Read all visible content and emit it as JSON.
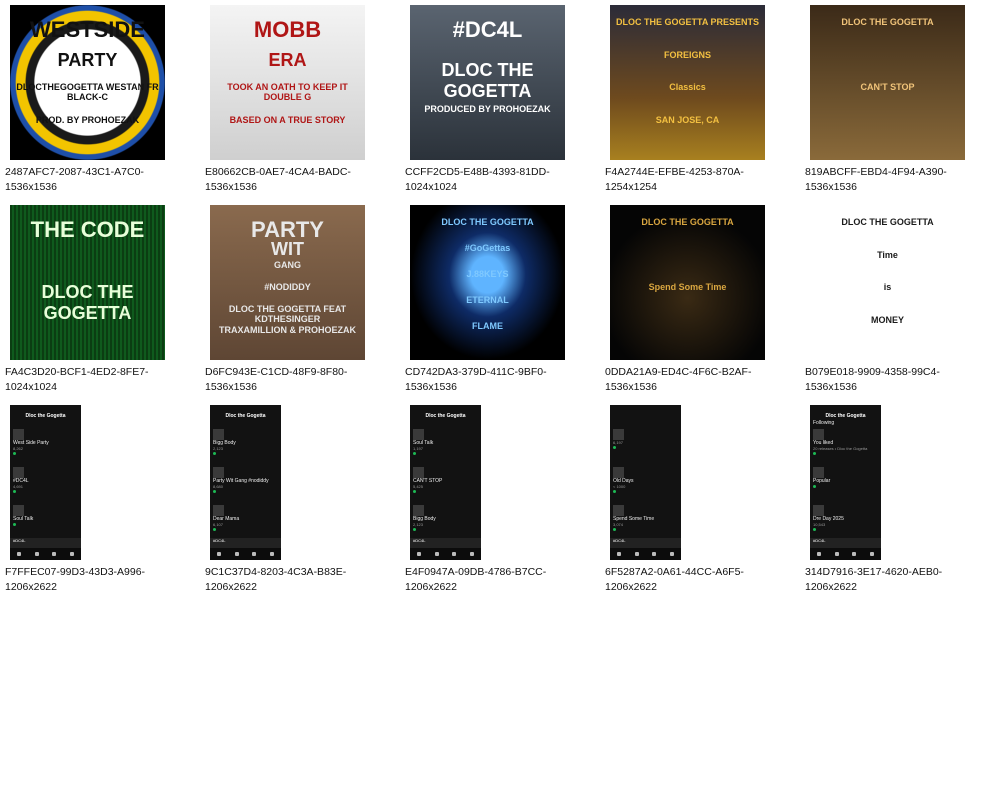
{
  "files": [
    {
      "line1": "2487AFC7-2087-43C1-A7C0-",
      "line2": "1536x1536",
      "kind": "album",
      "art": "westside",
      "texts": [
        "WESTSIDE",
        "PARTY",
        "DLOCTHEGOGETTA WESTAN FR BLACK-C",
        "PROD. BY PROHOEZAK"
      ]
    },
    {
      "line1": "E80662CB-0AE7-4CA4-BADC-",
      "line2": "1536x1536",
      "kind": "album",
      "art": "mobb",
      "texts": [
        "MOBB",
        "ERA",
        "TOOK AN OATH TO KEEP IT DOUBLE G",
        "BASED ON A TRUE STORY"
      ]
    },
    {
      "line1": "CCFF2CD5-E48B-4393-81DD-",
      "line2": "1024x1024",
      "kind": "album",
      "art": "dc4l",
      "texts": [
        "#DC4L",
        "DLOC THE GOGETTA",
        "PRODUCED BY PROHOEZAK"
      ]
    },
    {
      "line1": "F4A2744E-EFBE-4253-870A-",
      "line2": "1254x1254",
      "kind": "album",
      "art": "foreigns",
      "texts": [
        "DLOC THE GOGETTA PRESENTS",
        "FOREIGNS",
        "Classics",
        "SAN JOSE, CA"
      ]
    },
    {
      "line1": "819ABCFF-EBD4-4F94-A390-",
      "line2": "1536x1536",
      "kind": "album",
      "art": "cantstop",
      "texts": [
        "DLOC THE GOGETTA",
        "CAN'T STOP"
      ]
    },
    {
      "line1": "FA4C3D20-BCF1-4ED2-8FE7-",
      "line2": "1024x1024",
      "kind": "album",
      "art": "code",
      "texts": [
        "THE CODE",
        "DLOC THE GOGETTA"
      ]
    },
    {
      "line1": "D6FC943E-C1CD-48F9-8F80-",
      "line2": "1536x1536",
      "kind": "album",
      "art": "party",
      "texts": [
        "PARTY",
        "WIT",
        "GANG",
        "#NODIDDY",
        "DLOC THE GOGETTA FEAT KDTHESINGER",
        "TRAXAMILLION & PROHOEZAK"
      ]
    },
    {
      "line1": "CD742DA3-379D-411C-9BF0-",
      "line2": "1536x1536",
      "kind": "album",
      "art": "flame",
      "texts": [
        "DLOC THE GOGETTA",
        "#GoGettas",
        "J.88KEYS",
        "ETERNAL",
        "FLAME"
      ]
    },
    {
      "line1": "0DDA21A9-ED4C-4F6C-B2AF-",
      "line2": "1536x1536",
      "kind": "album",
      "art": "time",
      "texts": [
        "DLOC THE GOGETTA",
        "Spend Some Time"
      ]
    },
    {
      "line1": "B079E018-9909-4358-99C4-",
      "line2": "1536x1536",
      "kind": "album",
      "art": "money",
      "texts": [
        "DLOC THE GOGETTA",
        "Time",
        "is",
        "MONEY"
      ]
    },
    {
      "line1": "F7FFEC07-99D3-43D3-A996-",
      "line2": "1206x2622",
      "kind": "phone",
      "title": "Dloc the Gogetta",
      "rows": [
        {
          "label": "West Side Party",
          "sub": "8,262"
        },
        {
          "label": "#DC4L",
          "sub": "4,691"
        },
        {
          "label": "Soul Talk",
          "sub": ""
        }
      ],
      "bar": "#DC4L"
    },
    {
      "line1": "9C1C37D4-8203-4C3A-B83E-",
      "line2": "1206x2622",
      "kind": "phone",
      "title": "Dloc the Gogetta",
      "rows": [
        {
          "label": "Bigg Body",
          "sub": "2,123"
        },
        {
          "label": "Party Wit Gang #nodiddy",
          "sub": "8,680"
        },
        {
          "label": "Dear Mama",
          "sub": "6,107"
        }
      ],
      "bar": "#DC4L"
    },
    {
      "line1": "E4F0947A-09DB-4786-B7CC-",
      "line2": "1206x2622",
      "kind": "phone",
      "title": "Dloc the Gogetta",
      "rows": [
        {
          "label": "Soul Talk",
          "sub": "1,197"
        },
        {
          "label": "CAN'T STOP",
          "sub": "5,425"
        },
        {
          "label": "Bigg Body",
          "sub": "2,123"
        }
      ],
      "bar": "#DC4L"
    },
    {
      "line1": "6F5287A2-0A61-44CC-A6F5-",
      "line2": "1206x2622",
      "kind": "phone",
      "title": "",
      "rows": [
        {
          "label": "",
          "sub": "6,197"
        },
        {
          "label": "Old Days",
          "sub": "< 1000"
        },
        {
          "label": "Spend Some Time",
          "sub": "3,074"
        }
      ],
      "bar": "#DC4L"
    },
    {
      "line1": "314D7916-3E17-4620-AEB0-",
      "line2": "1206x2622",
      "kind": "phone",
      "title": "Dloc the Gogetta",
      "rows": [
        {
          "label": "You liked",
          "sub": "20 releases • Dloc the Gogetta"
        },
        {
          "label": "Popular",
          "sub": ""
        },
        {
          "label": "Dre Day 2025",
          "sub": "10,543"
        }
      ],
      "bar": "#DC4L",
      "following": "Following"
    }
  ],
  "colors": {
    "accent_green": "#1db954",
    "phone_bg": "#121212"
  }
}
